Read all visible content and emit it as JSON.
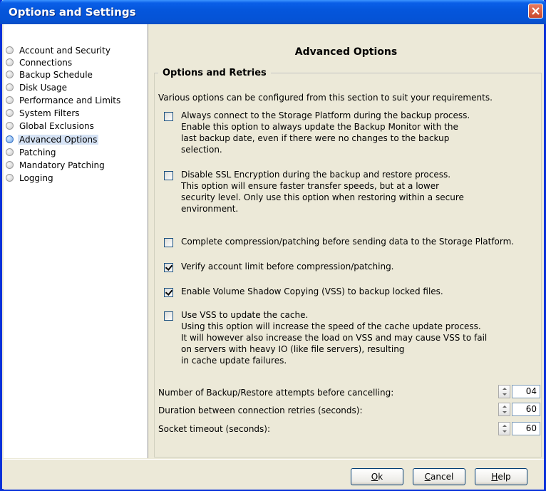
{
  "window": {
    "title": "Options and Settings"
  },
  "sidebar": {
    "items": [
      {
        "label": "Account and Security",
        "selected": false
      },
      {
        "label": "Connections",
        "selected": false
      },
      {
        "label": "Backup Schedule",
        "selected": false
      },
      {
        "label": "Disk Usage",
        "selected": false
      },
      {
        "label": "Performance and Limits",
        "selected": false
      },
      {
        "label": "System Filters",
        "selected": false
      },
      {
        "label": "Global Exclusions",
        "selected": false
      },
      {
        "label": "Advanced Options",
        "selected": true
      },
      {
        "label": "Patching",
        "selected": false
      },
      {
        "label": "Mandatory Patching",
        "selected": false
      },
      {
        "label": "Logging",
        "selected": false
      }
    ]
  },
  "main": {
    "title": "Advanced Options",
    "group_title": "Options and Retries",
    "description": "Various options can be configured from this section to suit your requirements.",
    "options": [
      {
        "main": "Always connect to the Storage Platform during the backup process.",
        "sub": "Enable this option to always update the Backup Monitor with the\nlast backup date, even if there were no changes to the backup\nselection.",
        "checked": false
      },
      {
        "main": "Disable SSL Encryption during the backup and restore process.",
        "sub": "This option will ensure faster transfer speeds, but at a lower\nsecurity level. Only use this option when restoring within a secure\nenvironment.",
        "checked": false
      },
      {
        "main": "Complete compression/patching before sending data to the Storage Platform.",
        "sub": "",
        "checked": false
      },
      {
        "main": "Verify account limit before compression/patching.",
        "sub": "",
        "checked": true
      },
      {
        "main": "Enable Volume Shadow Copying (VSS) to backup locked files.",
        "sub": "",
        "checked": true
      },
      {
        "main": "Use VSS to update the cache.",
        "sub": "Using this option will increase the speed of the cache update process.\nIt will however also increase the load on VSS and may cause VSS to fail\non servers with heavy IO (like file servers), resulting\nin cache update failures.",
        "checked": false
      }
    ],
    "fields": [
      {
        "label": "Number of Backup/Restore attempts before cancelling:",
        "value": "04"
      },
      {
        "label": "Duration between connection retries (seconds):",
        "value": "60"
      },
      {
        "label": "Socket timeout (seconds):",
        "value": "60"
      }
    ]
  },
  "footer": {
    "ok": {
      "mnemonic": "O",
      "rest": "k"
    },
    "cancel": {
      "mnemonic": "C",
      "rest": "ancel"
    },
    "help": {
      "mnemonic": "H",
      "rest": "elp"
    }
  }
}
